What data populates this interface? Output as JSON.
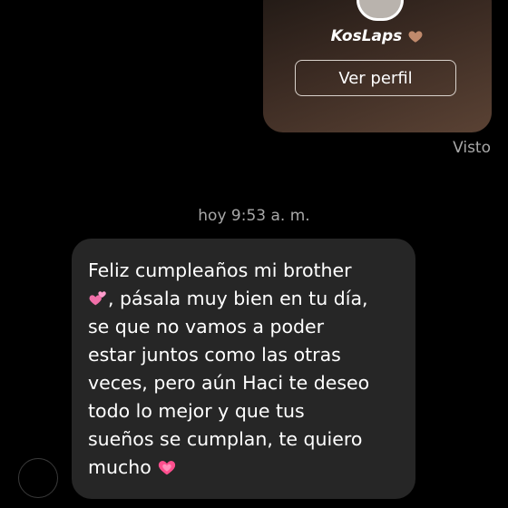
{
  "shared_profile": {
    "username": "KosLaps",
    "name_emoji_icon": "brown-heart-icon",
    "button_label": "Ver perfil"
  },
  "read_receipt": "Visto",
  "timestamp": "hoy 9:53 a. m.",
  "message": {
    "line1": "Feliz cumpleaños mi brother",
    "line2": ", pásala muy bien en tu día,",
    "rest": "se que no vamos a poder\nestar juntos como las otras\nveces, pero aún Haci te deseo\ntodo lo mejor y que tus\nsueños se cumplan, te quiero\nmucho",
    "emoji_1_icon": "revolving-hearts-icon",
    "emoji_2_icon": "growing-heart-icon"
  },
  "colors": {
    "background": "#000000",
    "bubble": "#262626",
    "muted_text": "#a8a8a8",
    "card_gradient_start": "#1f1814",
    "card_gradient_end": "#5a4234"
  }
}
